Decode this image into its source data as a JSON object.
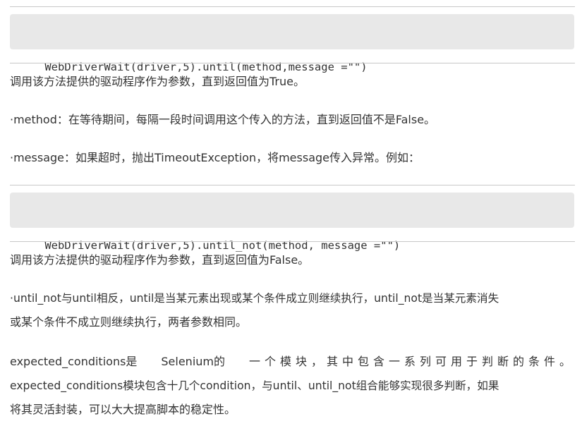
{
  "article": {
    "code_block_1": "WebDriverWait(driver,5).until(method,message =\"\")",
    "para_1": "调用该方法提供的驱动程序作为参数，直到返回值为True。",
    "para_2": "·method：在等待期间，每隔一段时间调用这个传入的方法，直到返回值不是False。",
    "para_3": "·message：如果超时，抛出TimeoutException，将message传入异常。例如：",
    "code_block_2": "WebDriverWait(driver,5).until_not(method, message =\"\")",
    "para_4": "调用该方法提供的驱动程序作为参数，直到返回值为False。",
    "para_5_line_1": "·until_not与until相反，until是当某元素出现或某个条件成立则继续执行，until_not是当某元素消失",
    "para_5_line_2": "或某个条件不成立则继续执行，两者参数相同。",
    "para_6_line_1_start": "expected_conditions是",
    "para_6_line_1_mid": "Selenium的",
    "para_6_line_1_end": "一个模块，其中包含一系列可用于判断的条件。",
    "para_6_line_2": "expected_conditions模块包含十几个condition，与until、until_not组合能够实现很多判断，如果",
    "para_6_line_3": "将其灵活封装，可以大大提高脚本的稳定性。"
  }
}
